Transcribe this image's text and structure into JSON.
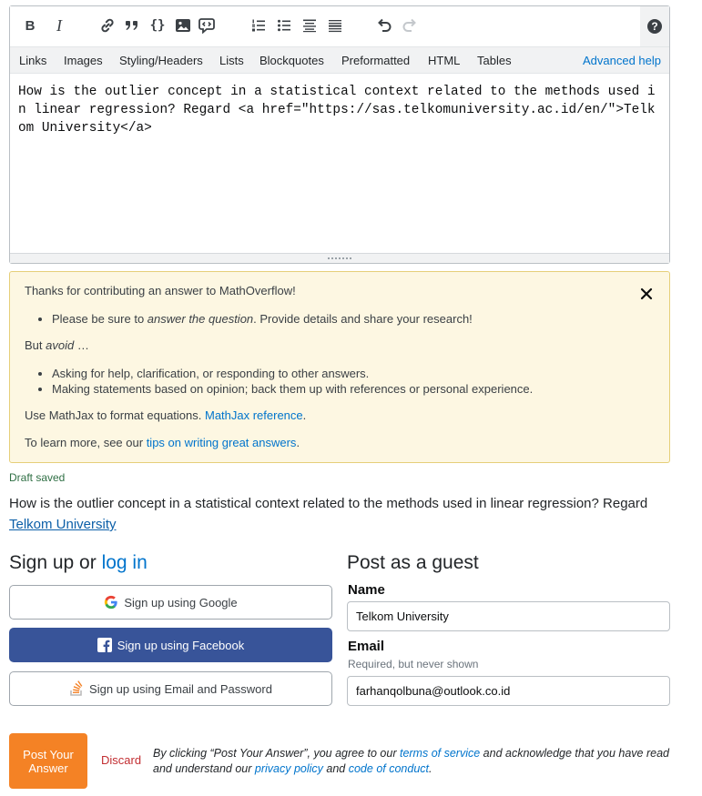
{
  "editor": {
    "toolbar": [
      {
        "name": "bold-icon",
        "glyph": "B"
      },
      {
        "name": "italic-icon",
        "glyph": "I"
      },
      {
        "name": "link-icon"
      },
      {
        "name": "blockquote-icon"
      },
      {
        "name": "code-icon",
        "glyph": "{}"
      },
      {
        "name": "image-icon"
      },
      {
        "name": "snippet-icon"
      },
      {
        "name": "ordered-list-icon"
      },
      {
        "name": "bulleted-list-icon"
      },
      {
        "name": "heading-icon"
      },
      {
        "name": "horizontal-rule-icon"
      },
      {
        "name": "undo-icon"
      },
      {
        "name": "redo-icon"
      },
      {
        "name": "help-icon",
        "glyph": "?"
      }
    ],
    "tabs": [
      "Links",
      "Images",
      "Styling/Headers",
      "Lists",
      "Blockquotes",
      "Preformatted",
      "HTML",
      "Tables"
    ],
    "advanced_help": "Advanced help",
    "content": "How is the outlier concept in a statistical context related to the methods used in linear regression? Regard <a href=\"https://sas.telkomuniversity.ac.id/en/\">Telkom University</a>"
  },
  "notice": {
    "intro": "Thanks for contributing an answer to MathOverflow!",
    "bullet1_pre": "Please be sure to ",
    "bullet1_em": "answer the question",
    "bullet1_post": ". Provide details and share your research!",
    "but": "But ",
    "avoid": "avoid",
    "ellipsis": " …",
    "avoid1": "Asking for help, clarification, or responding to other answers.",
    "avoid2": "Making statements based on opinion; back them up with references or personal experience.",
    "mathjax_pre": "Use MathJax to format equations. ",
    "mathjax_link": "MathJax reference",
    "mathjax_post": ".",
    "learn_pre": "To learn more, see our ",
    "learn_link": "tips on writing great answers",
    "learn_post": "."
  },
  "preview": {
    "draft_status": "Draft saved",
    "text": "How is the outlier concept in a statistical context related to the methods used in linear regression? Regard ",
    "link_text": "Telkom University"
  },
  "signup": {
    "heading": "Sign up or ",
    "login": "log in",
    "google": "Sign up using Google",
    "facebook": "Sign up using Facebook",
    "email": "Sign up using Email and Password"
  },
  "guest": {
    "heading": "Post as a guest",
    "name_label": "Name",
    "name_value": "Telkom University",
    "email_label": "Email",
    "email_hint": "Required, but never shown",
    "email_value": "farhanqolbuna@outlook.co.id"
  },
  "actions": {
    "post": "Post Your Answer",
    "discard": "Discard",
    "legal_1": "By clicking “Post Your Answer”, you agree to our ",
    "terms": "terms of service",
    "legal_2": " and acknowledge that you have read and understand our ",
    "privacy": "privacy policy",
    "legal_3": " and ",
    "conduct": "code of conduct",
    "legal_4": "."
  },
  "colors": {
    "accent": "#0074cc",
    "post_button": "#f48225",
    "facebook": "#385499",
    "notice_bg": "#fdf7e2",
    "draft_saved": "#2f6f44",
    "discard": "#c22e32"
  }
}
